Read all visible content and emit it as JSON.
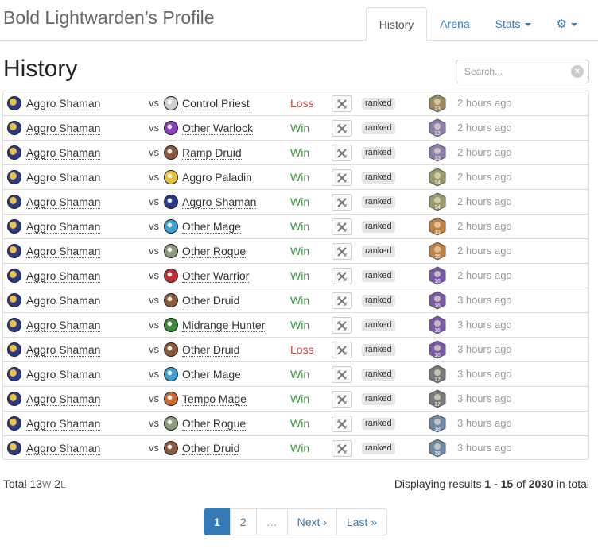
{
  "header": {
    "title": "Bold Lightwarden’s Profile",
    "tabs": [
      {
        "label": "History",
        "active": true
      },
      {
        "label": "Arena",
        "active": false
      },
      {
        "label": "Stats",
        "active": false
      }
    ],
    "settings_icon": "gear-icon"
  },
  "main": {
    "heading": "History",
    "search": {
      "placeholder": "Search...",
      "value": ""
    }
  },
  "vs_label": "vs",
  "colors": {
    "win": "#3c9a3c",
    "loss": "#b94a48",
    "link": "#337ab7"
  },
  "matches": [
    {
      "deck": "Aggro Shaman",
      "opponent": "Control Priest",
      "result": "Loss",
      "mode": "ranked",
      "rank": "13",
      "time": "2 hours ago",
      "opp_color": "#cfcfcf",
      "rank_color": "#a08a5a"
    },
    {
      "deck": "Aggro Shaman",
      "opponent": "Other Warlock",
      "result": "Win",
      "mode": "ranked",
      "rank": "13",
      "time": "2 hours ago",
      "opp_color": "#8b3fc4",
      "rank_color": "#8a7fa8"
    },
    {
      "deck": "Aggro Shaman",
      "opponent": "Ramp Druid",
      "result": "Win",
      "mode": "ranked",
      "rank": "13",
      "time": "2 hours ago",
      "opp_color": "#8a5a3a",
      "rank_color": "#8a7fa8"
    },
    {
      "deck": "Aggro Shaman",
      "opponent": "Aggro Paladin",
      "result": "Win",
      "mode": "ranked",
      "rank": "14",
      "time": "2 hours ago",
      "opp_color": "#e6c23a",
      "rank_color": "#9a9a6a"
    },
    {
      "deck": "Aggro Shaman",
      "opponent": "Aggro Shaman",
      "result": "Win",
      "mode": "ranked",
      "rank": "14",
      "time": "2 hours ago",
      "opp_color": "#2a3a8a",
      "rank_color": "#9a9a6a"
    },
    {
      "deck": "Aggro Shaman",
      "opponent": "Other Mage",
      "result": "Win",
      "mode": "ranked",
      "rank": "15",
      "time": "2 hours ago",
      "opp_color": "#3aa0d6",
      "rank_color": "#c08040"
    },
    {
      "deck": "Aggro Shaman",
      "opponent": "Other Rogue",
      "result": "Win",
      "mode": "ranked",
      "rank": "15",
      "time": "2 hours ago",
      "opp_color": "#8a9a7a",
      "rank_color": "#c08040"
    },
    {
      "deck": "Aggro Shaman",
      "opponent": "Other Warrior",
      "result": "Win",
      "mode": "ranked",
      "rank": "16",
      "time": "2 hours ago",
      "opp_color": "#c03030",
      "rank_color": "#7a5aa8"
    },
    {
      "deck": "Aggro Shaman",
      "opponent": "Other Druid",
      "result": "Win",
      "mode": "ranked",
      "rank": "16",
      "time": "3 hours ago",
      "opp_color": "#8a5a3a",
      "rank_color": "#7a5aa8"
    },
    {
      "deck": "Aggro Shaman",
      "opponent": "Midrange Hunter",
      "result": "Win",
      "mode": "ranked",
      "rank": "16",
      "time": "3 hours ago",
      "opp_color": "#3a8a3a",
      "rank_color": "#7a5aa8"
    },
    {
      "deck": "Aggro Shaman",
      "opponent": "Other Druid",
      "result": "Loss",
      "mode": "ranked",
      "rank": "16",
      "time": "3 hours ago",
      "opp_color": "#8a5a3a",
      "rank_color": "#7a5aa8"
    },
    {
      "deck": "Aggro Shaman",
      "opponent": "Other Mage",
      "result": "Win",
      "mode": "ranked",
      "rank": "17",
      "time": "3 hours ago",
      "opp_color": "#3aa0d6",
      "rank_color": "#7a7a7a"
    },
    {
      "deck": "Aggro Shaman",
      "opponent": "Tempo Mage",
      "result": "Win",
      "mode": "ranked",
      "rank": "17",
      "time": "3 hours ago",
      "opp_color": "#d06a30",
      "rank_color": "#7a7a7a"
    },
    {
      "deck": "Aggro Shaman",
      "opponent": "Other Rogue",
      "result": "Win",
      "mode": "ranked",
      "rank": "18",
      "time": "3 hours ago",
      "opp_color": "#8a9a7a",
      "rank_color": "#6a8aa8"
    },
    {
      "deck": "Aggro Shaman",
      "opponent": "Other Druid",
      "result": "Win",
      "mode": "ranked",
      "rank": "18",
      "time": "3 hours ago",
      "opp_color": "#8a5a3a",
      "rank_color": "#6a8aa8"
    }
  ],
  "totals": {
    "label": "Total",
    "wins": "13",
    "w_suffix": "W",
    "losses": "2",
    "l_suffix": "L"
  },
  "results_summary": {
    "prefix": "Displaying results",
    "range": "1 - 15",
    "of": "of",
    "total": "2030",
    "suffix": "in total"
  },
  "pagination": [
    "1",
    "2",
    "…",
    "Next ›",
    "Last »"
  ]
}
